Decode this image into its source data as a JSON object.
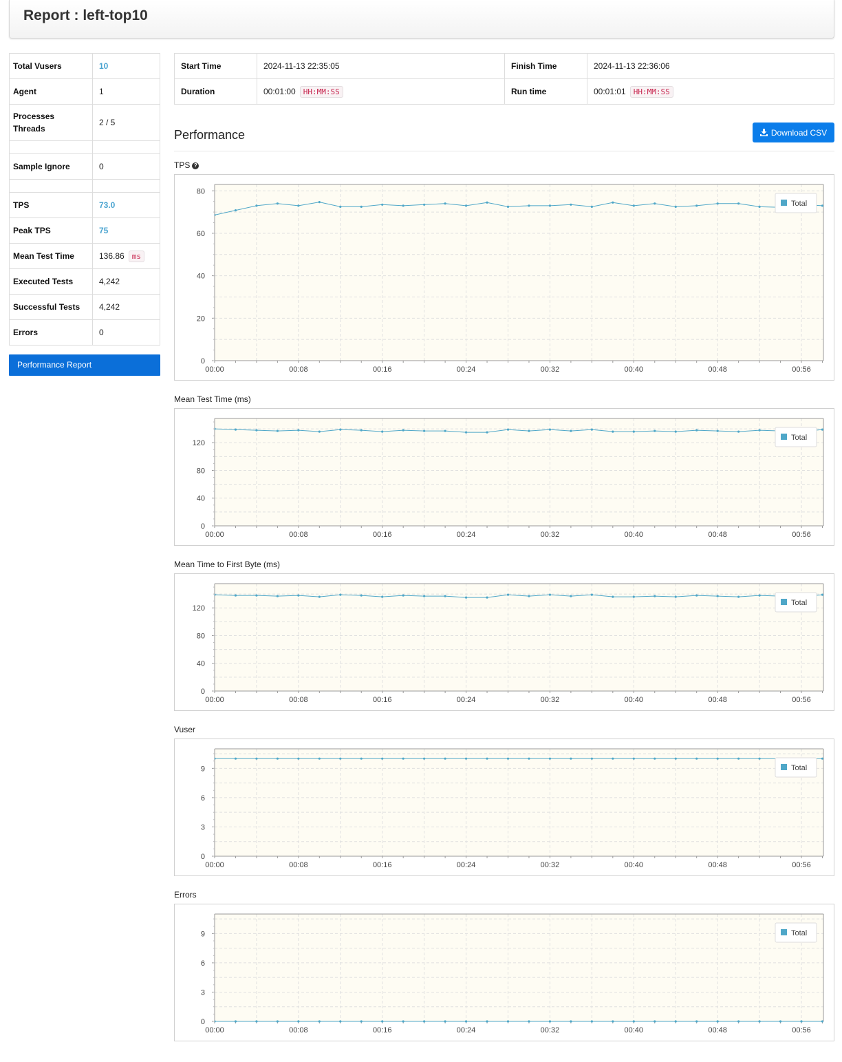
{
  "header": {
    "title": "Report : left-top10"
  },
  "summary": {
    "rows": [
      {
        "key": "Total Vusers",
        "value": "10"
      },
      {
        "key": "Agent",
        "value": "1"
      },
      {
        "key": "Processes",
        "key2": "Threads",
        "value": "2 / 5"
      },
      {
        "key": "Sample Ignore",
        "value": "0"
      },
      {
        "key": "TPS",
        "value": "73.0"
      },
      {
        "key": "Peak TPS",
        "value": "75"
      },
      {
        "key": "Mean Test Time",
        "value": "136.86",
        "unit": "ms"
      },
      {
        "key": "Executed Tests",
        "value": "4,242"
      },
      {
        "key": "Successful Tests",
        "value": "4,242"
      },
      {
        "key": "Errors",
        "value": "0"
      }
    ]
  },
  "sidebar": {
    "report_button": "Performance Report"
  },
  "info": {
    "start_label": "Start Time",
    "start_value": "2024-11-13 22:35:05",
    "finish_label": "Finish Time",
    "finish_value": "2024-11-13 22:36:06",
    "duration_label": "Duration",
    "duration_value": "00:01:00",
    "duration_format": "HH:MM:SS",
    "runtime_label": "Run time",
    "runtime_value": "00:01:01",
    "runtime_format": "HH:MM:SS"
  },
  "performance": {
    "title": "Performance",
    "download_label": "Download CSV"
  },
  "colors": {
    "line": "#4fa7c8",
    "plot_bg": "#fefcf3",
    "button": "#0b7dea"
  },
  "chart_data": [
    {
      "type": "line",
      "title": "TPS",
      "x": [
        "00:00",
        "00:02",
        "00:04",
        "00:06",
        "00:08",
        "00:10",
        "00:12",
        "00:14",
        "00:16",
        "00:18",
        "00:20",
        "00:22",
        "00:24",
        "00:26",
        "00:28",
        "00:30",
        "00:32",
        "00:34",
        "00:36",
        "00:38",
        "00:40",
        "00:42",
        "00:44",
        "00:46",
        "00:48",
        "00:50",
        "00:52",
        "00:54",
        "00:56",
        "00:58"
      ],
      "xticks": [
        "00:00",
        "00:08",
        "00:16",
        "00:24",
        "00:32",
        "00:40",
        "00:48",
        "00:56"
      ],
      "yticks": [
        0,
        20,
        40,
        60,
        80
      ],
      "ylim": [
        0,
        83
      ],
      "series": [
        {
          "name": "Total",
          "values": [
            68.6,
            70.8,
            73,
            74,
            73,
            74.7,
            72.5,
            72.5,
            73.5,
            73,
            73.5,
            74,
            73,
            74.5,
            72.5,
            73,
            73,
            73.5,
            72.5,
            74.5,
            73,
            74,
            72.5,
            73,
            74,
            74,
            72.5,
            72.2,
            73.5,
            73
          ]
        }
      ]
    },
    {
      "type": "line",
      "title": "Mean Test Time (ms)",
      "x": [
        "00:00",
        "00:02",
        "00:04",
        "00:06",
        "00:08",
        "00:10",
        "00:12",
        "00:14",
        "00:16",
        "00:18",
        "00:20",
        "00:22",
        "00:24",
        "00:26",
        "00:28",
        "00:30",
        "00:32",
        "00:34",
        "00:36",
        "00:38",
        "00:40",
        "00:42",
        "00:44",
        "00:46",
        "00:48",
        "00:50",
        "00:52",
        "00:54",
        "00:56",
        "00:58"
      ],
      "xticks": [
        "00:00",
        "00:08",
        "00:16",
        "00:24",
        "00:32",
        "00:40",
        "00:48",
        "00:56"
      ],
      "yticks": [
        0,
        40,
        80,
        120
      ],
      "ylim": [
        0,
        155
      ],
      "series": [
        {
          "name": "Total",
          "values": [
            140,
            139,
            138,
            137,
            138,
            136,
            139,
            138,
            136,
            138,
            137,
            137,
            135,
            135,
            139,
            137,
            139,
            137,
            139,
            136,
            136,
            137,
            136,
            138,
            137,
            136,
            138,
            137,
            136,
            139
          ]
        }
      ]
    },
    {
      "type": "line",
      "title": "Mean Time to First Byte (ms)",
      "x": [
        "00:00",
        "00:02",
        "00:04",
        "00:06",
        "00:08",
        "00:10",
        "00:12",
        "00:14",
        "00:16",
        "00:18",
        "00:20",
        "00:22",
        "00:24",
        "00:26",
        "00:28",
        "00:30",
        "00:32",
        "00:34",
        "00:36",
        "00:38",
        "00:40",
        "00:42",
        "00:44",
        "00:46",
        "00:48",
        "00:50",
        "00:52",
        "00:54",
        "00:56",
        "00:58"
      ],
      "xticks": [
        "00:00",
        "00:08",
        "00:16",
        "00:24",
        "00:32",
        "00:40",
        "00:48",
        "00:56"
      ],
      "yticks": [
        0,
        40,
        80,
        120
      ],
      "ylim": [
        0,
        155
      ],
      "series": [
        {
          "name": "Total",
          "values": [
            139,
            138,
            138,
            137,
            138,
            136,
            139,
            138,
            136,
            138,
            137,
            137,
            135,
            135,
            139,
            137,
            139,
            137,
            139,
            136,
            136,
            137,
            136,
            138,
            137,
            136,
            138,
            137,
            136,
            139
          ]
        }
      ]
    },
    {
      "type": "line",
      "title": "Vuser",
      "x": [
        "00:00",
        "00:02",
        "00:04",
        "00:06",
        "00:08",
        "00:10",
        "00:12",
        "00:14",
        "00:16",
        "00:18",
        "00:20",
        "00:22",
        "00:24",
        "00:26",
        "00:28",
        "00:30",
        "00:32",
        "00:34",
        "00:36",
        "00:38",
        "00:40",
        "00:42",
        "00:44",
        "00:46",
        "00:48",
        "00:50",
        "00:52",
        "00:54",
        "00:56",
        "00:58"
      ],
      "xticks": [
        "00:00",
        "00:08",
        "00:16",
        "00:24",
        "00:32",
        "00:40",
        "00:48",
        "00:56"
      ],
      "yticks": [
        0,
        3,
        6,
        9
      ],
      "ylim": [
        0,
        11
      ],
      "series": [
        {
          "name": "Total",
          "values": [
            10,
            10,
            10,
            10,
            10,
            10,
            10,
            10,
            10,
            10,
            10,
            10,
            10,
            10,
            10,
            10,
            10,
            10,
            10,
            10,
            10,
            10,
            10,
            10,
            10,
            10,
            10,
            10,
            10,
            10
          ]
        }
      ]
    },
    {
      "type": "line",
      "title": "Errors",
      "x": [
        "00:00",
        "00:02",
        "00:04",
        "00:06",
        "00:08",
        "00:10",
        "00:12",
        "00:14",
        "00:16",
        "00:18",
        "00:20",
        "00:22",
        "00:24",
        "00:26",
        "00:28",
        "00:30",
        "00:32",
        "00:34",
        "00:36",
        "00:38",
        "00:40",
        "00:42",
        "00:44",
        "00:46",
        "00:48",
        "00:50",
        "00:52",
        "00:54",
        "00:56",
        "00:58"
      ],
      "xticks": [
        "00:00",
        "00:08",
        "00:16",
        "00:24",
        "00:32",
        "00:40",
        "00:48",
        "00:56"
      ],
      "yticks": [
        0,
        3,
        6,
        9
      ],
      "ylim": [
        0,
        11
      ],
      "series": [
        {
          "name": "Total",
          "values": [
            0,
            0,
            0,
            0,
            0,
            0,
            0,
            0,
            0,
            0,
            0,
            0,
            0,
            0,
            0,
            0,
            0,
            0,
            0,
            0,
            0,
            0,
            0,
            0,
            0,
            0,
            0,
            0,
            0,
            0
          ]
        }
      ]
    }
  ]
}
